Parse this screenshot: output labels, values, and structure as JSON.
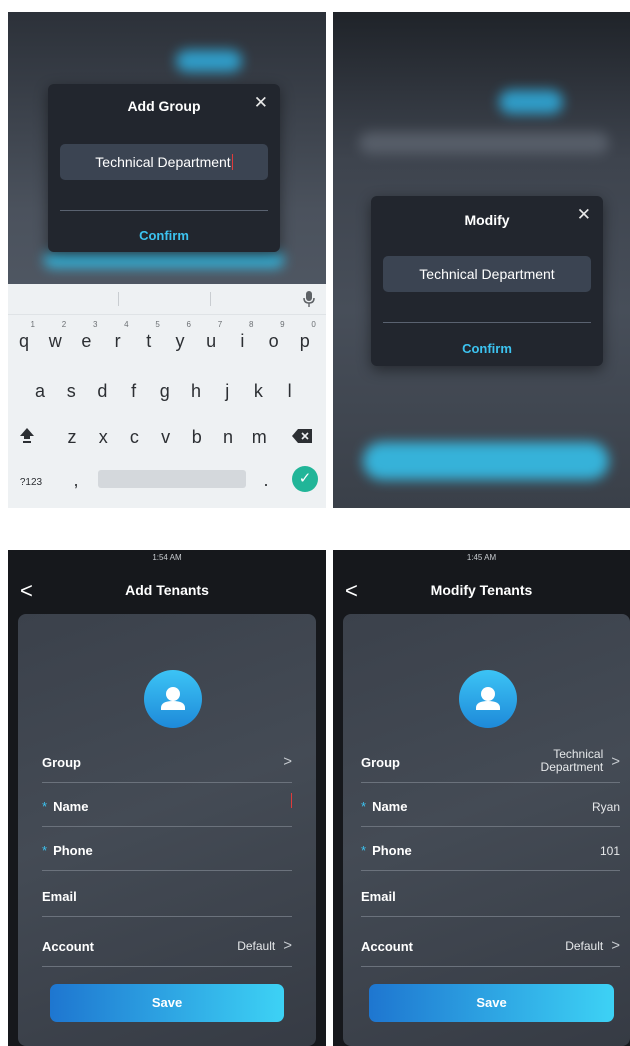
{
  "add_group_dialog": {
    "title": "Add Group",
    "close_glyph": "✕",
    "input_value": "Technical Department",
    "confirm_label": "Confirm"
  },
  "keyboard": {
    "row1": [
      {
        "key": "q",
        "hint": "1"
      },
      {
        "key": "w",
        "hint": "2"
      },
      {
        "key": "e",
        "hint": "3"
      },
      {
        "key": "r",
        "hint": "4"
      },
      {
        "key": "t",
        "hint": "5"
      },
      {
        "key": "y",
        "hint": "6"
      },
      {
        "key": "u",
        "hint": "7"
      },
      {
        "key": "i",
        "hint": "8"
      },
      {
        "key": "o",
        "hint": "9"
      },
      {
        "key": "p",
        "hint": "0"
      }
    ],
    "row2": [
      "a",
      "s",
      "d",
      "f",
      "g",
      "h",
      "j",
      "k",
      "l"
    ],
    "row3": [
      "z",
      "x",
      "c",
      "v",
      "b",
      "n",
      "m"
    ],
    "shift_glyph": "⬆",
    "delete_glyph": "⌫",
    "mic_glyph": "🎙",
    "symbols_label": "?123",
    "comma_label": ",",
    "period_label": ".",
    "enter_glyph": "✓",
    "accent_color": "#21b598"
  },
  "modify_dialog": {
    "title": "Modify",
    "close_glyph": "✕",
    "input_value": "Technical Department",
    "confirm_label": "Confirm"
  },
  "add_tenants": {
    "time": "1:54 AM",
    "back_glyph": "<",
    "title": "Add Tenants",
    "rows": {
      "group": {
        "label": "Group",
        "value": ""
      },
      "name": {
        "label": "Name",
        "required": "*",
        "value": ""
      },
      "phone": {
        "label": "Phone",
        "required": "*",
        "value": ""
      },
      "email": {
        "label": "Email",
        "value": ""
      },
      "account": {
        "label": "Account",
        "value": "Default"
      }
    },
    "chevron": ">",
    "save_label": "Save"
  },
  "modify_tenants": {
    "time": "1:45 AM",
    "back_glyph": "<",
    "title": "Modify Tenants",
    "rows": {
      "group": {
        "label": "Group",
        "value_line1": "Technical",
        "value_line2": "Department"
      },
      "name": {
        "label": "Name",
        "required": "*",
        "value": "Ryan"
      },
      "phone": {
        "label": "Phone",
        "required": "*",
        "value": "101"
      },
      "email": {
        "label": "Email",
        "value": ""
      },
      "account": {
        "label": "Account",
        "value": "Default"
      }
    },
    "chevron": ">",
    "save_label": "Save"
  },
  "colors": {
    "accent_blue": "#3cc3f0",
    "dialog_bg": "#22262e",
    "field_bg": "#3b4452",
    "save_gradient_start": "#1e76d0",
    "save_gradient_end": "#3dd2f5"
  }
}
